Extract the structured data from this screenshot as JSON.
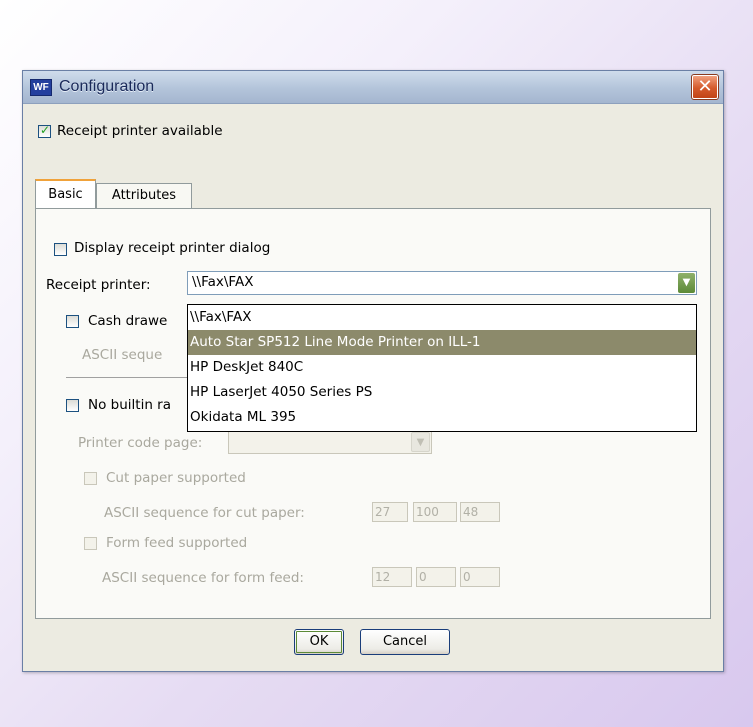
{
  "window": {
    "title": "Configuration",
    "app_icon_text": "WF",
    "close_glyph": "✕"
  },
  "receipt_available": {
    "label": "Receipt printer available",
    "checked": true
  },
  "tabs": [
    {
      "label": "Basic",
      "active": true
    },
    {
      "label": "Attributes",
      "active": false
    }
  ],
  "basic": {
    "display_dialog": {
      "label": "Display receipt printer dialog",
      "checked": false
    },
    "receipt_printer_label": "Receipt printer:",
    "receipt_printer_value": "\\\\Fax\\FAX",
    "dropdown_options": [
      "\\\\Fax\\FAX",
      "Auto Star SP512 Line Mode Printer on ILL-1",
      "HP DeskJet 840C",
      "HP LaserJet 4050 Series PS",
      "Okidata ML 395"
    ],
    "selected_index": 1,
    "cash_drawer": {
      "label": "Cash drawe",
      "checked": false
    },
    "ascii_sequence_label": "ASCII seque",
    "no_builtin": {
      "label": "No builtin ra",
      "checked": false
    },
    "printer_code_page_label": "Printer code page:",
    "cut_paper": {
      "label": "Cut paper supported",
      "checked": false
    },
    "cut_paper_seq_label": "ASCII sequence for cut paper:",
    "cut_paper_seq": [
      "27",
      "100",
      "48"
    ],
    "form_feed": {
      "label": "Form feed supported",
      "checked": false
    },
    "form_feed_seq_label": "ASCII sequence for form feed:",
    "form_feed_seq": [
      "12",
      "0",
      "0"
    ]
  },
  "buttons": {
    "ok": "OK",
    "cancel": "Cancel"
  },
  "colors": {
    "title_bar": "#b3c4da",
    "close_button": "#d45a2c",
    "selection": "#8c8a6b",
    "check": "#21a121"
  }
}
